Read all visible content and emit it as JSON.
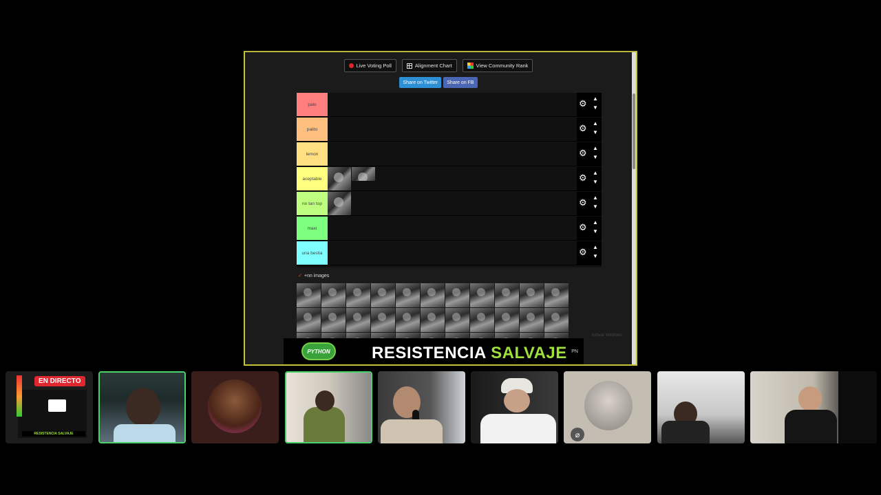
{
  "top_buttons": {
    "live_voting": "Live Voting Poll",
    "alignment": "Alignment Chart",
    "community": "View Community Rank"
  },
  "share_buttons": {
    "twitter": "Share on Twitter",
    "fb": "Share on FB"
  },
  "tiers": [
    {
      "label": "palo",
      "color": "#ff7f7f",
      "items": 0
    },
    {
      "label": "palito",
      "color": "#ffbf7f",
      "items": 0
    },
    {
      "label": "lemon",
      "color": "#ffdf7f",
      "items": 0
    },
    {
      "label": "aceptable",
      "color": "#ffff7f",
      "items": 2
    },
    {
      "label": "no tan top",
      "color": "#bfff7f",
      "items": 1
    },
    {
      "label": "maxi",
      "color": "#7fff7f",
      "items": 0
    },
    {
      "label": "una bestia",
      "color": "#7fffff",
      "items": 0
    }
  ],
  "unranked_title": "+nn images",
  "activate_text": "Activar Windows",
  "banner": {
    "logo_text": "PYTHON",
    "title_white": "RESISTENCIA",
    "title_green": "SALVAJE",
    "corner": "PN"
  },
  "live_badge": "EN DIRECTO",
  "mini_banner": "RESISTENCIA SALVAJE",
  "colors": {
    "accent_green": "#9fe03a",
    "speaking_border": "#4cd26a",
    "live_red": "#e0262f"
  }
}
